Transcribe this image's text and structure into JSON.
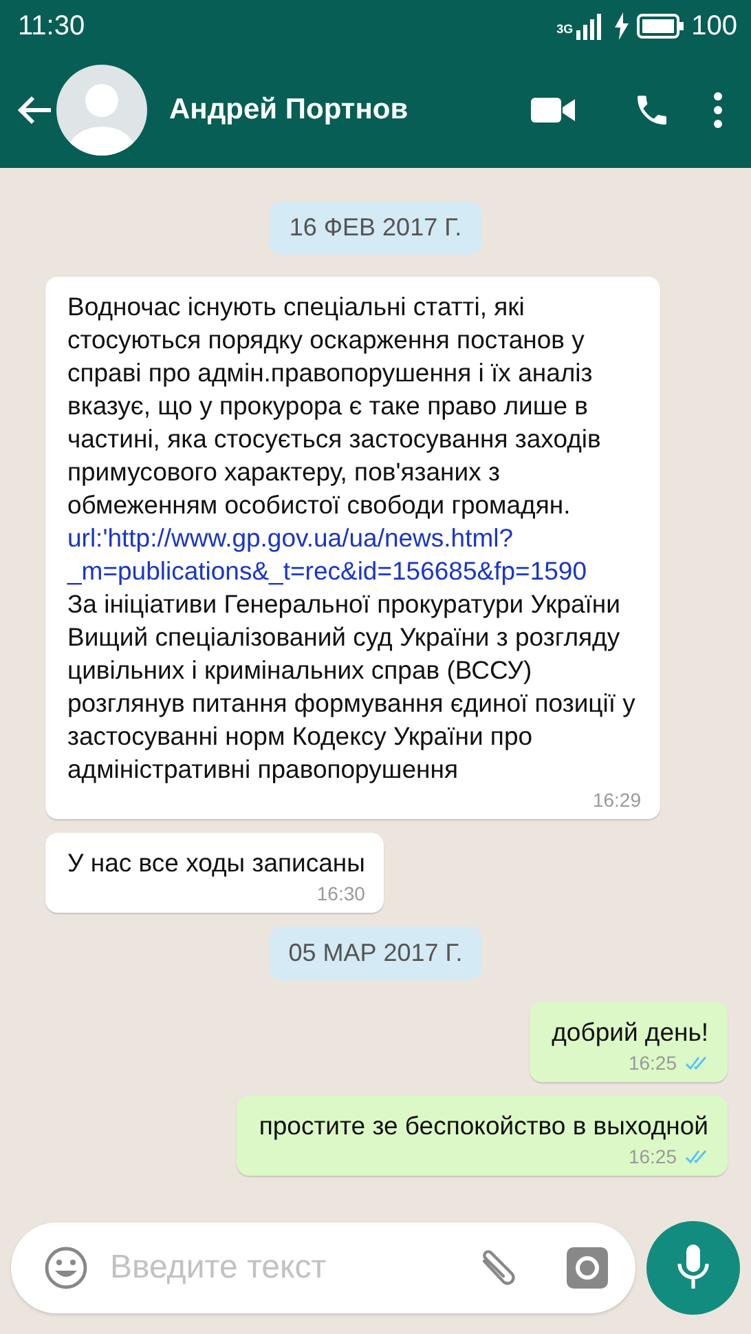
{
  "status_bar": {
    "time": "11:30",
    "network": "3G",
    "battery": "100"
  },
  "header": {
    "contact_name": "Андрей Портнов"
  },
  "messages": [
    {
      "kind": "date",
      "text": "16 ФЕВ 2017 Г."
    },
    {
      "kind": "in",
      "parts": [
        {
          "kind": "text",
          "text": "Водночас існують спеціальні статті, які стосуються порядку оскарження постанов у справі про адмін.правопорушення і їх аналіз вказує, що у прокурора є таке право лише в частині, яка стосується застосування заходів примусового характеру, пов'язаних з обмеженням особистої свободи громадян."
        },
        {
          "kind": "link",
          "text": "url:'http://www.gp.gov.ua/ua/news.html?_m=publications&_t=rec&id=156685&fp=1590"
        },
        {
          "kind": "text",
          "text": "За ініціативи Генеральної прокуратури України Вищий спеціалізований суд України з розгляду цивільних і кримінальних справ (ВССУ) розглянув питання формування єдиної позиції у застосуванні норм Кодексу України про адміністративні правопорушення"
        }
      ],
      "time": "16:29"
    },
    {
      "kind": "in",
      "parts": [
        {
          "kind": "text",
          "text": "У нас все ходы записаны"
        }
      ],
      "time": "16:30"
    },
    {
      "kind": "date",
      "text": "05 МАР 2017 Г."
    },
    {
      "kind": "out",
      "parts": [
        {
          "kind": "text",
          "text": "добрий день!"
        }
      ],
      "time": "16:25",
      "read": true
    },
    {
      "kind": "out",
      "parts": [
        {
          "kind": "text",
          "text": "простите зе беспокойство в выходной"
        }
      ],
      "time": "16:25",
      "read": true
    }
  ],
  "composer": {
    "placeholder": "Введите текст"
  }
}
